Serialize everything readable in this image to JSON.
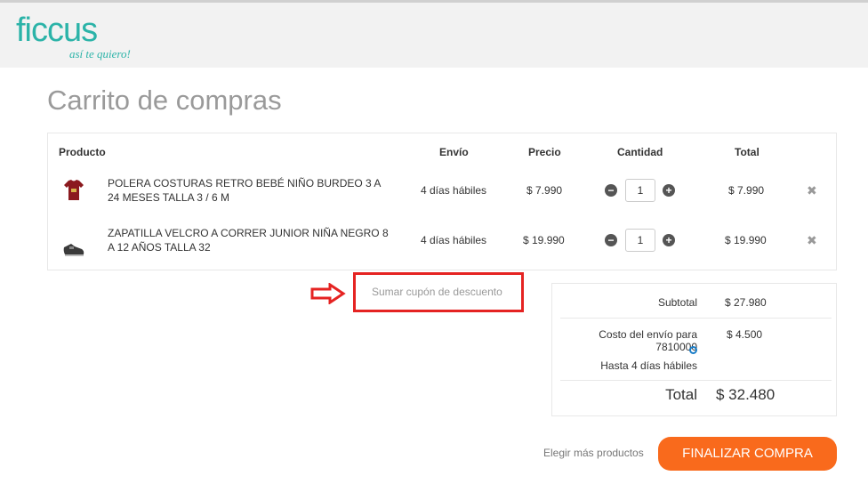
{
  "brand": {
    "name": "ficcus",
    "tagline": "así te quiero!",
    "accent": "#2bb3a8"
  },
  "page": {
    "title": "Carrito de compras"
  },
  "cart": {
    "headers": {
      "product": "Producto",
      "shipping": "Envío",
      "price": "Precio",
      "quantity": "Cantidad",
      "total": "Total"
    },
    "items": [
      {
        "name": "POLERA COSTURAS RETRO BEBÉ NIÑO BURDEO 3 A 24 MESES TALLA 3 / 6 M",
        "shipping": "4 días hábiles",
        "price": "$ 7.990",
        "quantity": "1",
        "total": "$ 7.990",
        "image": "shirt-image"
      },
      {
        "name": "ZAPATILLA VELCRO A CORRER JUNIOR NIÑA NEGRO 8 A 12 AÑOS TALLA 32",
        "shipping": "4 días hábiles",
        "price": "$ 19.990",
        "quantity": "1",
        "total": "$ 19.990",
        "image": "shoe-image"
      }
    ]
  },
  "coupon": {
    "label": "Sumar cupón de descuento",
    "highlight_color": "#e52322"
  },
  "summary": {
    "subtotal_label": "Subtotal",
    "subtotal": "$ 27.980",
    "shipping_label": "Costo del envío para 7810000",
    "shipping": "$ 4.500",
    "shipping_time": "Hasta 4 días hábiles",
    "total_label": "Total",
    "total": "$ 32.480"
  },
  "actions": {
    "more_products": "Elegir más productos",
    "checkout": "FINALIZAR COMPRA",
    "checkout_color": "#f96a1c"
  }
}
